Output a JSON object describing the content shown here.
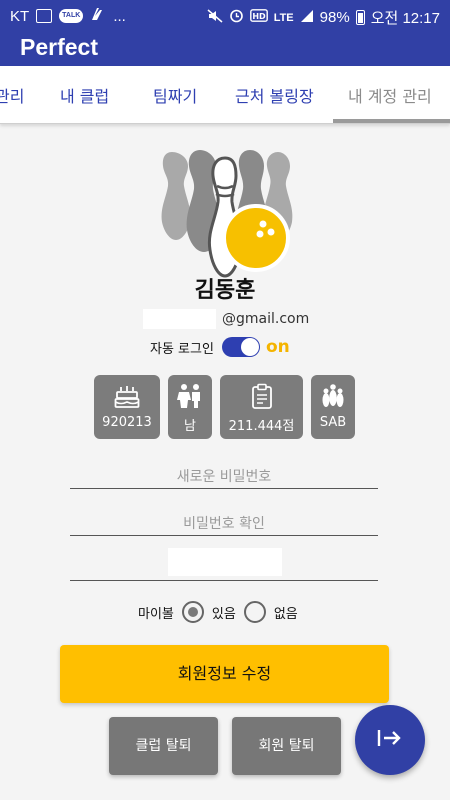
{
  "status_bar": {
    "carrier": "KT",
    "more": "...",
    "talk_badge": "TALK",
    "network": "LTE",
    "battery": "98%",
    "time": "오전 12:17"
  },
  "app_bar": {
    "title": "Perfect"
  },
  "tabs": [
    {
      "label": "관리"
    },
    {
      "label": "내 클럽"
    },
    {
      "label": "팀짜기"
    },
    {
      "label": "근처 볼링장"
    },
    {
      "label": "내 계정 관리",
      "active": true
    }
  ],
  "profile": {
    "name": "김동훈",
    "email_domain": "@gmail.com"
  },
  "auto_login": {
    "label": "자동 로그인",
    "state": "on",
    "enabled": true
  },
  "info_tiles": [
    {
      "icon": "cake-icon",
      "value": "920213"
    },
    {
      "icon": "gender-icon",
      "value": "남"
    },
    {
      "icon": "clipboard-icon",
      "value": "211.444점"
    },
    {
      "icon": "bowling-pins-icon",
      "value": "SAB"
    }
  ],
  "form": {
    "new_password_placeholder": "새로운 비밀번호",
    "confirm_password_placeholder": "비밀번호 확인"
  },
  "my_ball": {
    "label": "마이볼",
    "options": [
      "있음",
      "없음"
    ],
    "selected": "있음"
  },
  "buttons": {
    "update": "회원정보 수정",
    "leave_club": "클럽 탈퇴",
    "withdraw": "회원 탈퇴"
  },
  "fab": {
    "icon": "logout-arrow-icon"
  },
  "colors": {
    "primary": "#3140a5",
    "accent": "#ffbf00",
    "tile": "#7c7c7c"
  }
}
